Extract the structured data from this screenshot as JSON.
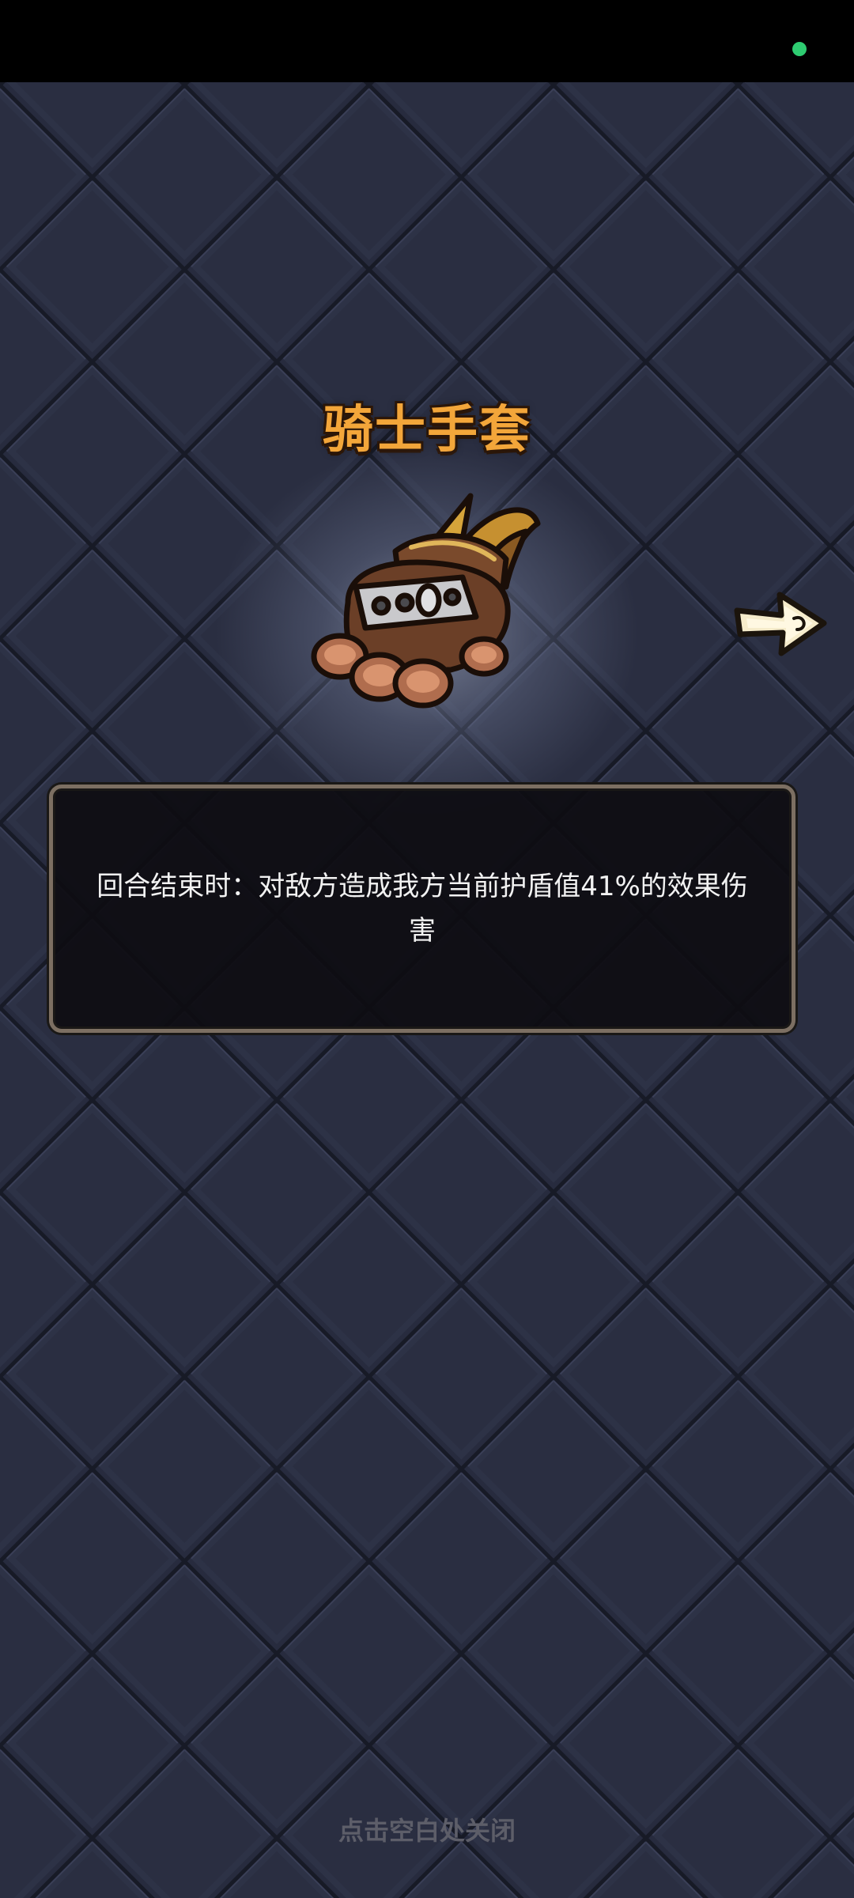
{
  "status_bar": {
    "indicator_color": "#2ecc71"
  },
  "item": {
    "name": "骑士手套",
    "icon": "knight-gauntlet-icon",
    "description": "回合结束时：对敌方造成我方当前护盾值41%的效果伤害"
  },
  "navigation": {
    "next_icon": "right-arrow-icon"
  },
  "footer": {
    "close_hint": "点击空白处关闭"
  },
  "colors": {
    "title": "#f3a63a",
    "background": "#272b3e",
    "panel_border": "#7c6f62",
    "hint_text": "#5d5e69"
  }
}
